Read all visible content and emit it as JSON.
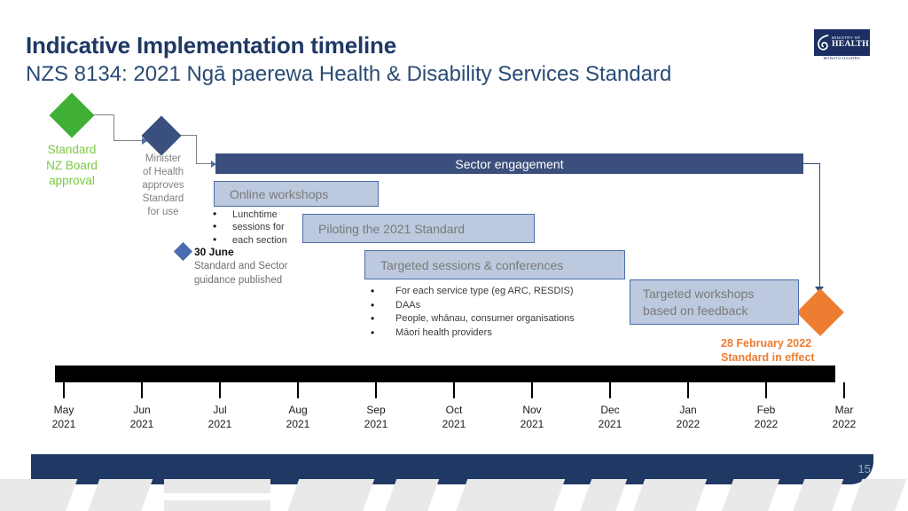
{
  "slide": {
    "title_line1": "Indicative Implementation timeline",
    "title_line2": "NZS 8134: 2021 Ngā paerewa Health & Disability Services Standard",
    "page_number": "15"
  },
  "logo": {
    "line1": "MINISTRY OF",
    "line2": "HEALTH",
    "sub": "MANATŪ HAUORA"
  },
  "milestones": {
    "green": {
      "label": "Standard\nNZ Board\napproval",
      "color": "#3faf35",
      "text_color": "#7ac943"
    },
    "navy": {
      "label": "Minister\nof Health\napproves\nStandard\nfor use",
      "color": "#39507f",
      "text_color": "#808080"
    },
    "june": {
      "date": "30 June",
      "description": "Standard and Sector\nguidance published",
      "color": "#4a6bb0"
    },
    "orange": {
      "date": "28 February 2022",
      "description": "Standard in effect",
      "color": "#ed7d31",
      "text_color": "#ed7d31"
    }
  },
  "bars": {
    "sector_engagement": "Sector engagement",
    "online_workshops": "Online workshops",
    "piloting": "Piloting the 2021 Standard",
    "targeted_sessions": "Targeted sessions & conferences",
    "targeted_workshops_line1": "Targeted workshops",
    "targeted_workshops_line2": "based on feedback"
  },
  "notes": {
    "lunchtime": [
      "Lunchtime",
      "sessions for",
      "each section"
    ],
    "targeted_bullets": [
      "For each service type (eg ARC, RESDIS)",
      "DAAs",
      "People, whānau, consumer organisations",
      "Māori health providers"
    ]
  },
  "chart_data": {
    "type": "timeline",
    "title": "Indicative Implementation timeline",
    "axis": {
      "ticks": [
        {
          "month": "May",
          "year": "2021"
        },
        {
          "month": "Jun",
          "year": "2021"
        },
        {
          "month": "Jul",
          "year": "2021"
        },
        {
          "month": "Aug",
          "year": "2021"
        },
        {
          "month": "Sep",
          "year": "2021"
        },
        {
          "month": "Oct",
          "year": "2021"
        },
        {
          "month": "Nov",
          "year": "2021"
        },
        {
          "month": "Dec",
          "year": "2021"
        },
        {
          "month": "Jan",
          "year": "2022"
        },
        {
          "month": "Feb",
          "year": "2022"
        },
        {
          "month": "Mar",
          "year": "2022"
        }
      ]
    },
    "colors": {
      "title": "#1f3864",
      "dark_bar": "#3b4f7d",
      "light_box": "#bcc9de",
      "light_box_border": "#4a6ca8",
      "green": "#3faf35",
      "orange": "#ed7d31",
      "navy": "#1f3864",
      "axis": "#000000"
    }
  }
}
